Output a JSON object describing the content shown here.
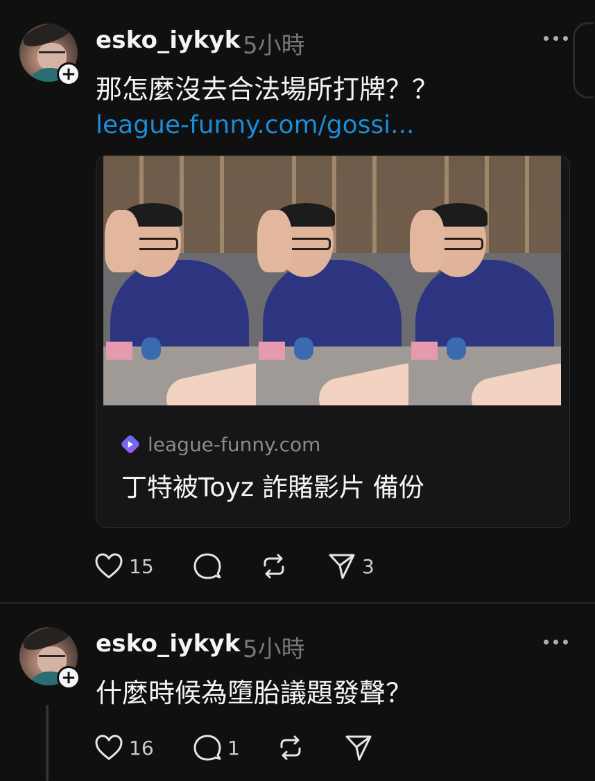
{
  "post1": {
    "username": "esko_iykyk",
    "timestamp": "5小時",
    "text": "那怎麼沒去合法場所打牌？？",
    "link": "league-funny.com/gossi...",
    "card": {
      "site": "league-funny.com",
      "title": "丁特被Toyz 詐賭影片 備份"
    },
    "likes": "15",
    "shares": "3"
  },
  "post2": {
    "username": "esko_iykyk",
    "timestamp": "5小時",
    "text": "什麼時候為墮胎議題發聲？",
    "likes": "16",
    "replies": "1"
  },
  "icons": {
    "like": "heart-icon",
    "reply": "comment-icon",
    "repost": "repost-icon",
    "share": "send-icon",
    "more": "more-dots-icon",
    "follow": "plus-icon",
    "site": "play-icon"
  },
  "colors": {
    "background": "#101010",
    "link": "#1a8cd8",
    "muted": "#777777",
    "text": "#f3f5f7"
  }
}
